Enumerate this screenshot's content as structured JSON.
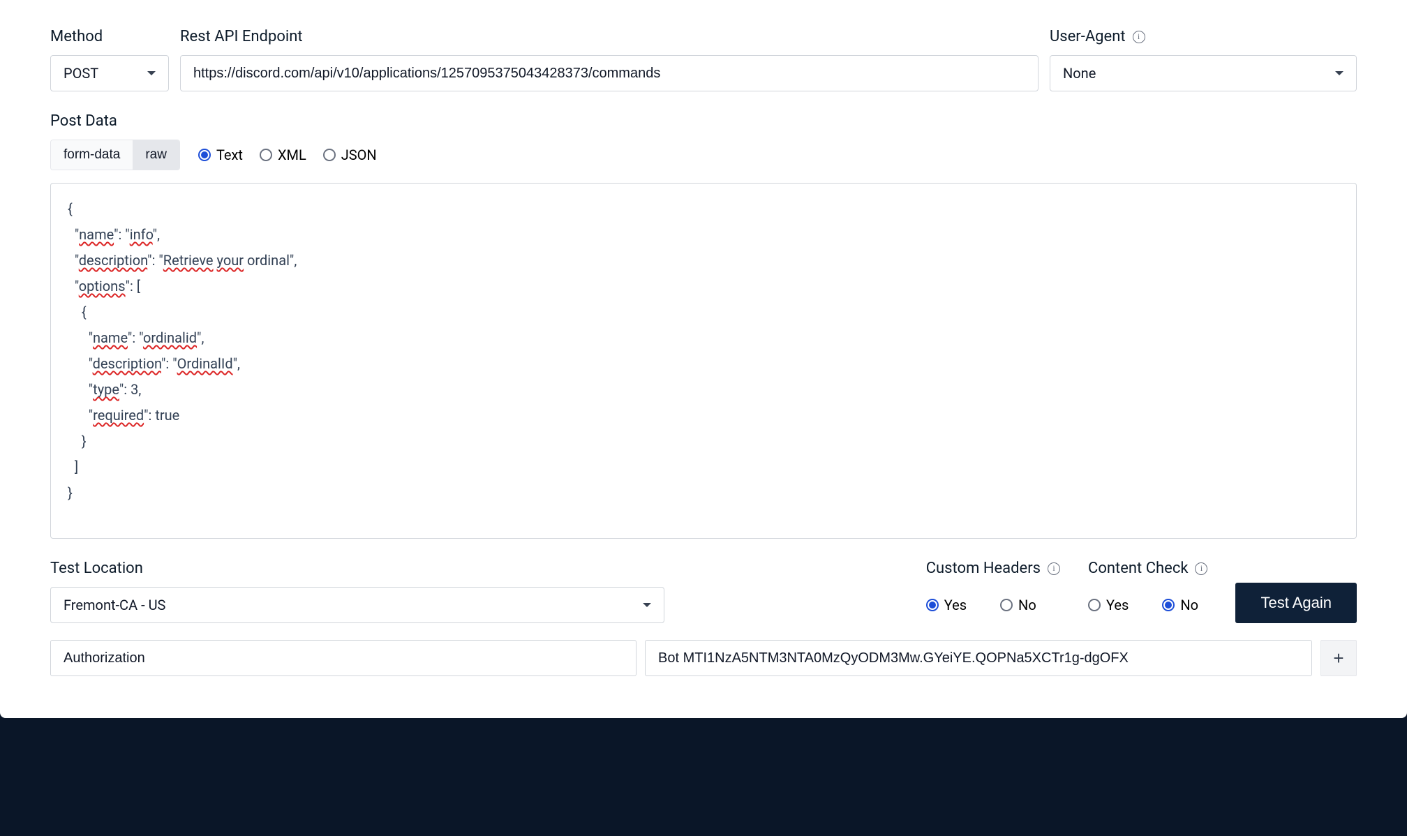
{
  "labels": {
    "method": "Method",
    "endpoint": "Rest API Endpoint",
    "userAgent": "User-Agent",
    "postData": "Post Data",
    "testLocation": "Test Location",
    "customHeaders": "Custom Headers",
    "contentCheck": "Content Check"
  },
  "method": {
    "value": "POST"
  },
  "endpoint": {
    "value": "https://discord.com/api/v10/applications/1257095375043428373/commands"
  },
  "userAgent": {
    "value": "None"
  },
  "postData": {
    "tabs": {
      "formData": "form-data",
      "raw": "raw",
      "active": "raw"
    },
    "format": {
      "options": {
        "text": "Text",
        "xml": "XML",
        "json": "JSON"
      },
      "selected": "text"
    },
    "body": "{\n  \"name\": \"info\",\n  \"description\": \"Retrieve your ordinal\",\n  \"options\": [\n    {\n      \"name\": \"ordinalid\",\n      \"description\": \"OrdinalId\",\n      \"type\": 3,\n      \"required\": true\n    }\n  ]\n}"
  },
  "testLocation": {
    "value": "Fremont-CA - US"
  },
  "customHeaders": {
    "options": {
      "yes": "Yes",
      "no": "No"
    },
    "selected": "yes"
  },
  "contentCheck": {
    "options": {
      "yes": "Yes",
      "no": "No"
    },
    "selected": "no"
  },
  "testButton": "Test Again",
  "headerRow": {
    "key": "Authorization",
    "value": "Bot MTI1NzA5NTM3NTA0MzQyODM3Mw.GYeiYE.QOPNa5XCTr1g-dgOFX"
  },
  "icons": {
    "info": "i",
    "plus": "+"
  }
}
